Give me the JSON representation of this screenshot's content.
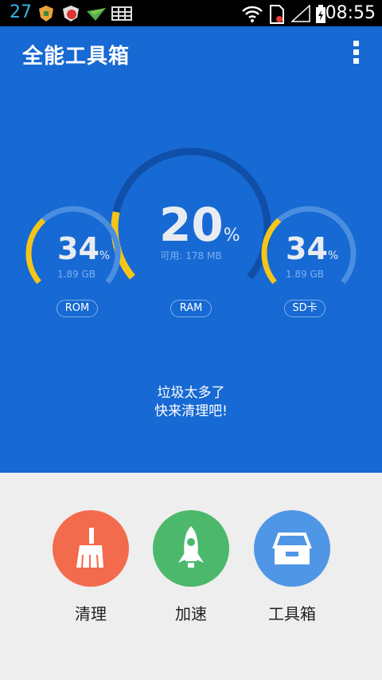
{
  "status_bar": {
    "notification_count": "27",
    "time": "08:55"
  },
  "header": {
    "title": "全能工具箱"
  },
  "gauges": {
    "ram": {
      "percent": "20",
      "unit": "%",
      "subtitle": "可用: 178 MB",
      "label": "RAM",
      "fraction": 0.2
    },
    "rom": {
      "percent": "34",
      "unit": "%",
      "subtitle": "1.89 GB",
      "label": "ROM",
      "fraction": 0.34
    },
    "sd": {
      "percent": "34",
      "unit": "%",
      "subtitle": "1.89 GB",
      "label": "SD卡",
      "fraction": 0.34
    }
  },
  "message": {
    "line1": "垃圾太多了",
    "line2": "快来清理吧!"
  },
  "actions": [
    {
      "label": "清理",
      "color": "#f26b4d"
    },
    {
      "label": "加速",
      "color": "#4cb86c"
    },
    {
      "label": "工具箱",
      "color": "#4f96e6"
    }
  ],
  "colors": {
    "primary_blue": "#1769d3",
    "gauge_track": "#4a8ee0",
    "gauge_fill": "#f5c518",
    "background": "#eeeeee"
  }
}
